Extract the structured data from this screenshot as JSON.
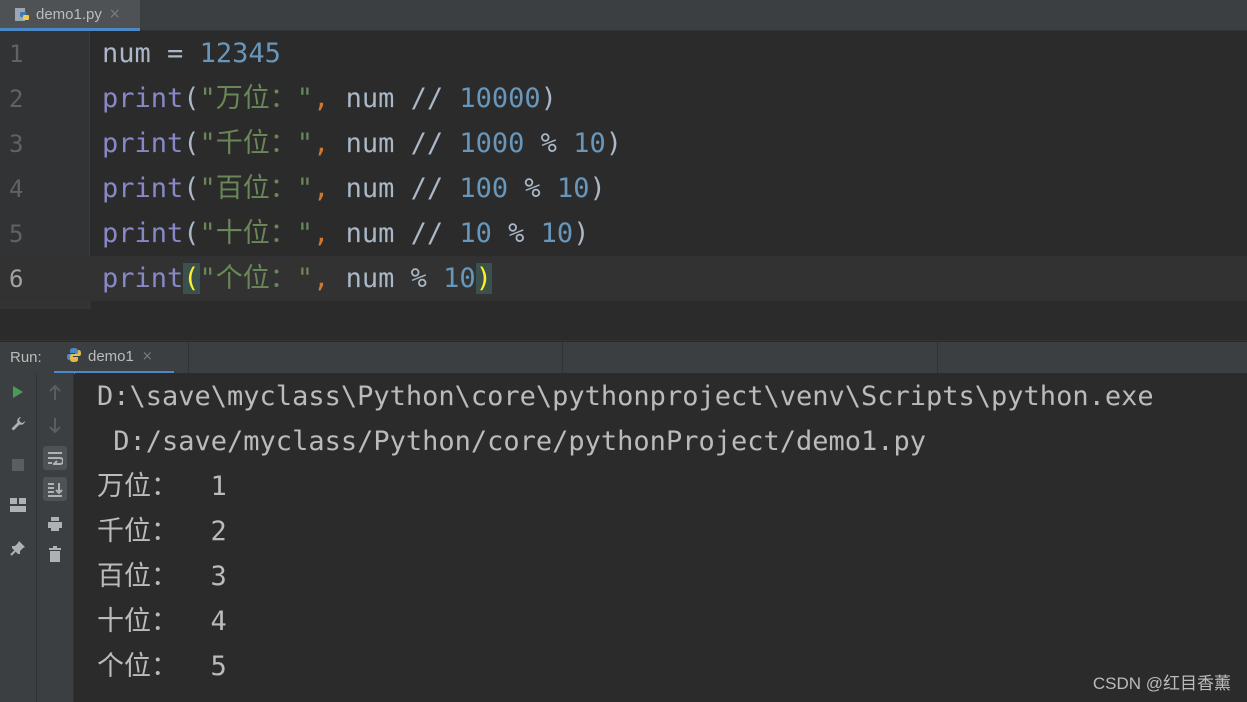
{
  "editor_tab": {
    "label": "demo1.py",
    "close": "×"
  },
  "code_lines": [
    {
      "num": "1",
      "parts": [
        [
          "id",
          "num"
        ],
        [
          "op",
          " = "
        ],
        [
          "num",
          "12345"
        ]
      ]
    },
    {
      "num": "2",
      "parts": [
        [
          "kw",
          "print"
        ],
        [
          "op",
          "("
        ],
        [
          "str",
          "\"万位：\""
        ],
        [
          "comma",
          ","
        ],
        [
          "op",
          " num // "
        ],
        [
          "num",
          "10000"
        ],
        [
          "op",
          ")"
        ]
      ]
    },
    {
      "num": "3",
      "parts": [
        [
          "kw",
          "print"
        ],
        [
          "op",
          "("
        ],
        [
          "str",
          "\"千位：\""
        ],
        [
          "comma",
          ","
        ],
        [
          "op",
          " num // "
        ],
        [
          "num",
          "1000"
        ],
        [
          "op",
          " % "
        ],
        [
          "num",
          "10"
        ],
        [
          "op",
          ")"
        ]
      ]
    },
    {
      "num": "4",
      "parts": [
        [
          "kw",
          "print"
        ],
        [
          "op",
          "("
        ],
        [
          "str",
          "\"百位：\""
        ],
        [
          "comma",
          ","
        ],
        [
          "op",
          " num // "
        ],
        [
          "num",
          "100"
        ],
        [
          "op",
          " % "
        ],
        [
          "num",
          "10"
        ],
        [
          "op",
          ")"
        ]
      ]
    },
    {
      "num": "5",
      "parts": [
        [
          "kw",
          "print"
        ],
        [
          "op",
          "("
        ],
        [
          "str",
          "\"十位：\""
        ],
        [
          "comma",
          ","
        ],
        [
          "op",
          " num // "
        ],
        [
          "num",
          "10"
        ],
        [
          "op",
          " % "
        ],
        [
          "num",
          "10"
        ],
        [
          "op",
          ")"
        ]
      ]
    },
    {
      "num": "6",
      "parts": [
        [
          "kw",
          "print"
        ],
        [
          "bm",
          "("
        ],
        [
          "str",
          "\"个位：\""
        ],
        [
          "comma",
          ","
        ],
        [
          "op",
          " num % "
        ],
        [
          "num",
          "10"
        ],
        [
          "bm",
          ")"
        ]
      ]
    }
  ],
  "run": {
    "label": "Run:",
    "tab_label": "demo1",
    "tab_close": "×",
    "console_lines": [
      "D:\\save\\myclass\\Python\\core\\pythonproject\\venv\\Scripts\\python.exe",
      " D:/save/myclass/Python/core/pythonProject/demo1.py",
      "万位：  1",
      "千位：  2",
      "百位：  3",
      "十位：  4",
      "个位：  5"
    ]
  },
  "watermark": "CSDN @红目香薰",
  "colors": {
    "accent": "#4a88c7",
    "run_green": "#499c54",
    "keyword": "#8888c6",
    "string": "#6a8759",
    "number": "#6897bb"
  }
}
